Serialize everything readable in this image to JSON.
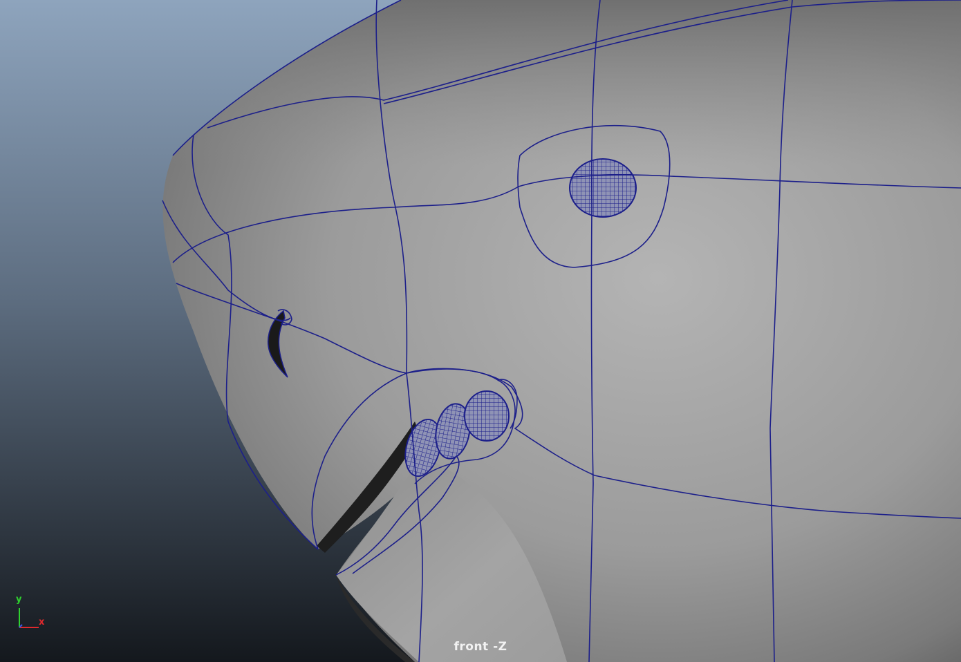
{
  "viewport": {
    "camera_label": "front -Z",
    "axis": {
      "y_label": "y",
      "x_label": "x",
      "y_color": "#2fd12f",
      "x_color": "#e0292d"
    }
  },
  "colors": {
    "background_top": "#8da3bd",
    "background_bottom": "#15191e",
    "surface": "#9a9a9a",
    "wireframe": "#1c1f8a"
  }
}
